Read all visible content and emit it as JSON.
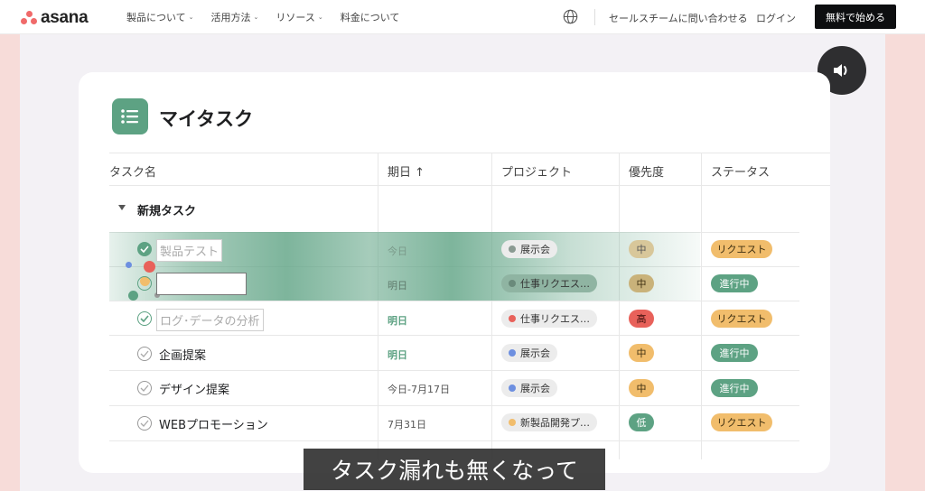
{
  "nav": {
    "logo": "asana",
    "items": [
      {
        "label": "製品について"
      },
      {
        "label": "活用方法"
      },
      {
        "label": "リソース"
      },
      {
        "label": "料金について"
      }
    ],
    "contact_sales": "セールスチームに問い合わせる",
    "login": "ログイン",
    "cta": "無料で始める"
  },
  "card": {
    "title": "マイタスク",
    "columns": {
      "task": "タスク名",
      "date": "期日 ↑",
      "project": "プロジェクト",
      "priority": "優先度",
      "status": "ステータス"
    },
    "section": "新規タスク",
    "rows": [
      {
        "name": "製品テスト",
        "date": "今日",
        "project": "展示会",
        "priority": "中",
        "status": "リクエスト"
      },
      {
        "name": "",
        "date": "明日",
        "project": "仕事リクエス…",
        "priority": "中",
        "status": "進行中"
      },
      {
        "name": "ログ･データの分析",
        "date": "明日",
        "project": "仕事リクエス…",
        "priority": "高",
        "status": "リクエスト"
      },
      {
        "name": "企画提案",
        "date": "明日",
        "project": "展示会",
        "priority": "中",
        "status": "進行中"
      },
      {
        "name": "デザイン提案",
        "date": "今日-7月17日",
        "project": "展示会",
        "priority": "中",
        "status": "進行中"
      },
      {
        "name": "WEBプロモーション",
        "date": "7月31日",
        "project": "新製品開発プ…",
        "priority": "低",
        "status": "リクエスト"
      }
    ]
  },
  "subtitle": "タスク漏れも無くなって",
  "colors": {
    "accent_green": "#5da283",
    "status_request": "#f1bd6c",
    "status_progress": "#5da283",
    "priority_mid": "#f1bd6c",
    "priority_high": "#e8615a",
    "priority_low": "#5da283",
    "project_exhibit": "#6d8fe0",
    "project_work": "#e8615a",
    "project_new": "#f1bd6c"
  }
}
